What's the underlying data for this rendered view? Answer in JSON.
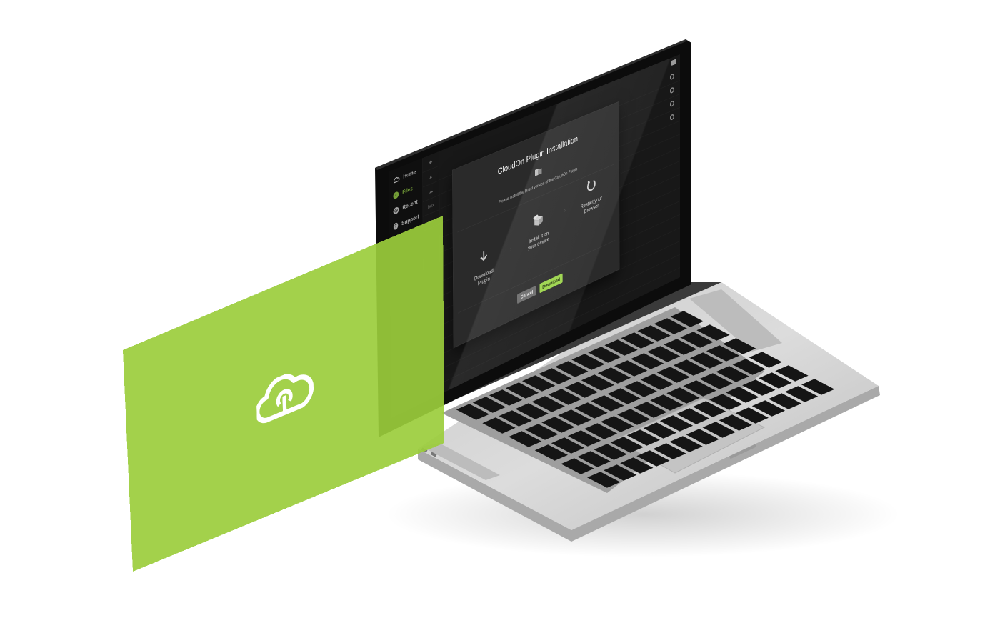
{
  "sidebar": {
    "items": [
      {
        "label": "Home",
        "icon": "cloud-logo-icon"
      },
      {
        "label": "Files",
        "icon": "folder-icon",
        "active": true
      },
      {
        "label": "Recent",
        "icon": "clock-icon"
      },
      {
        "label": "Support",
        "icon": "support-icon"
      }
    ]
  },
  "filecol": {
    "items": [
      "",
      "",
      "",
      "box",
      ""
    ]
  },
  "dialog": {
    "title": "CloudOn Plugin Installation",
    "subtitle": "Please install the latest version of the CloudOn Plugin",
    "steps": [
      {
        "label_line1": "Download",
        "label_line2": "Plugin",
        "icon": "download-arrow-icon"
      },
      {
        "label_line1": "Install it on",
        "label_line2": "your device",
        "icon": "open-box-icon"
      },
      {
        "label_line1": "Restart your",
        "label_line2": "Browser",
        "icon": "restart-icon"
      }
    ],
    "cancel_label": "Cancel",
    "download_label": "Download"
  },
  "card": {
    "logo": "cloudon-logo-icon"
  },
  "colors": {
    "accent": "#9bd34a",
    "card": "#a3cd4f",
    "screen_bg": "#1c1c1c",
    "dialog_bg": "#2a2a2a",
    "laptop_body": "#d9d9d9"
  }
}
